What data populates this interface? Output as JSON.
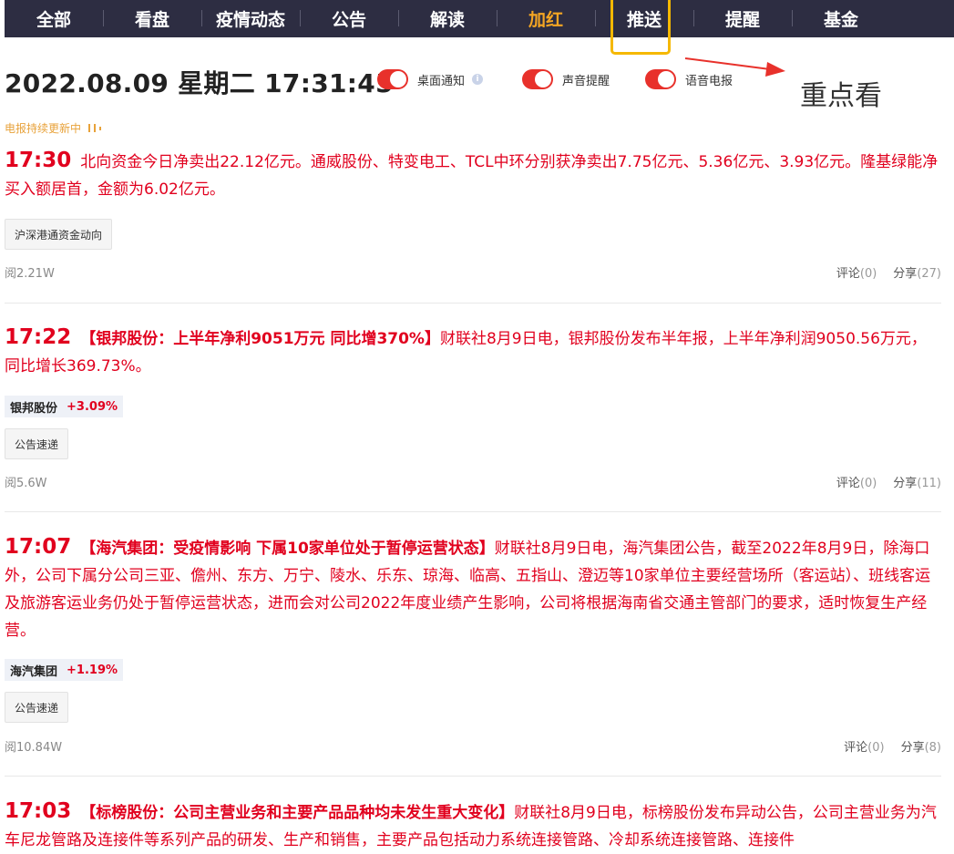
{
  "nav": {
    "items": [
      {
        "label": "全部"
      },
      {
        "label": "看盘"
      },
      {
        "label": "疫情动态"
      },
      {
        "label": "公告"
      },
      {
        "label": "解读"
      },
      {
        "label": "加红"
      },
      {
        "label": "推送"
      },
      {
        "label": "提醒"
      },
      {
        "label": "基金"
      }
    ],
    "active_color": "#f5a623"
  },
  "header": {
    "datetime": "2022.08.09 星期二 17:31:45",
    "toggles": [
      {
        "label": "桌面通知",
        "on": true
      },
      {
        "label": "声音提醒",
        "on": true
      },
      {
        "label": "语音电报",
        "on": true
      }
    ],
    "annotation": "重点看",
    "updating_text": "电报持续更新中"
  },
  "colors": {
    "accent_red": "#e1001e",
    "toggle_red": "#e8312b",
    "highlight_yellow": "#f5b800"
  },
  "news": [
    {
      "time": "17:30",
      "title": "",
      "body": "北向资金今日净卖出22.12亿元。通威股份、特变电工、TCL中环分别获净卖出7.75亿元、5.36亿元、3.93亿元。隆基绿能净买入额居首，金额为6.02亿元。",
      "stock": null,
      "tag": "沪深港通资金动向",
      "reads": "阅2.21W",
      "comment_label": "评论",
      "comments": "(0)",
      "share_label": "分享",
      "shares": "(27)"
    },
    {
      "time": "17:22",
      "title": "【银邦股份：上半年净利9051万元 同比增370%】",
      "body": "财联社8月9日电，银邦股份发布半年报，上半年净利润9050.56万元，同比增长369.73%。",
      "stock": {
        "name": "银邦股份",
        "change": "+3.09%"
      },
      "tag": "公告速递",
      "reads": "阅5.6W",
      "comment_label": "评论",
      "comments": "(0)",
      "share_label": "分享",
      "shares": "(11)"
    },
    {
      "time": "17:07",
      "title": "【海汽集团：受疫情影响 下属10家单位处于暂停运营状态】",
      "body": "财联社8月9日电，海汽集团公告，截至2022年8月9日，除海口外，公司下属分公司三亚、儋州、东方、万宁、陵水、乐东、琼海、临高、五指山、澄迈等10家单位主要经营场所（客运站）、班线客运及旅游客运业务仍处于暂停运营状态，进而会对公司2022年度业绩产生影响，公司将根据海南省交通主管部门的要求，适时恢复生产经营。",
      "stock": {
        "name": "海汽集团",
        "change": "+1.19%"
      },
      "tag": "公告速递",
      "reads": "阅10.84W",
      "comment_label": "评论",
      "comments": "(0)",
      "share_label": "分享",
      "shares": "(8)"
    },
    {
      "time": "17:03",
      "title": "【标榜股份：公司主营业务和主要产品品种均未发生重大变化】",
      "body": "财联社8月9日电，标榜股份发布异动公告，公司主营业务为汽车尼龙管路及连接件等系列产品的研发、生产和销售，主要产品包括动力系统连接管路、冷却系统连接管路、连接件",
      "stock": null,
      "tag": "",
      "reads": "",
      "comment_label": "",
      "comments": "",
      "share_label": "",
      "shares": ""
    }
  ]
}
